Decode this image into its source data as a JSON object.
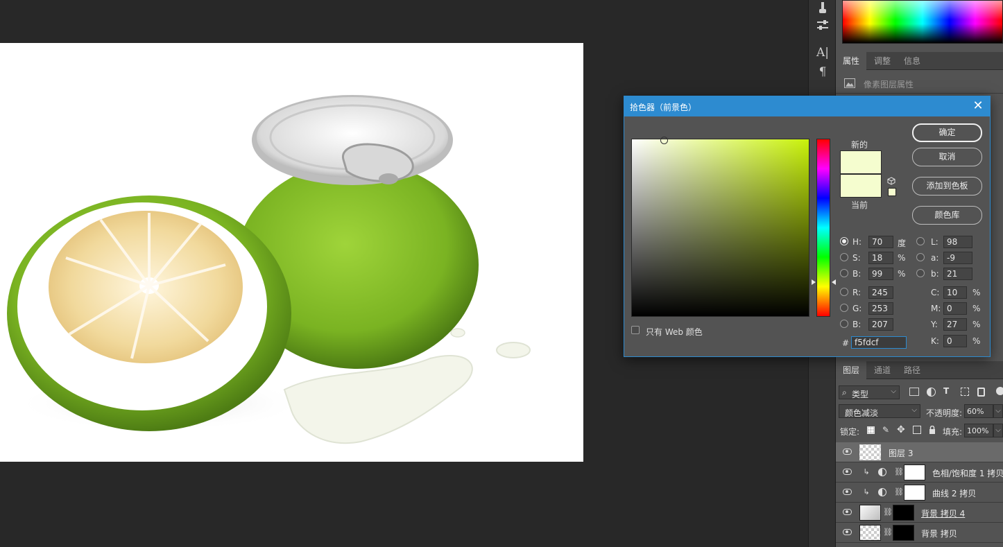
{
  "dialog": {
    "title": "拾色器（前景色）",
    "new_label": "新的",
    "current_label": "当前",
    "new_color": "#f5fdcf",
    "current_color": "#f5fdcf",
    "buttons": {
      "ok": "确定",
      "cancel": "取消",
      "add_swatch": "添加到色板",
      "color_library": "颜色库"
    },
    "web_only_label": "只有 Web 颜色",
    "web_only_checked": false,
    "hsb": [
      {
        "label": "H:",
        "value": "70",
        "unit": "度",
        "selected": true
      },
      {
        "label": "S:",
        "value": "18",
        "unit": "%",
        "selected": false
      },
      {
        "label": "B:",
        "value": "99",
        "unit": "%",
        "selected": false
      }
    ],
    "lab": [
      {
        "label": "L:",
        "value": "98"
      },
      {
        "label": "a:",
        "value": "-9"
      },
      {
        "label": "b:",
        "value": "21"
      }
    ],
    "rgb": [
      {
        "label": "R:",
        "value": "245"
      },
      {
        "label": "G:",
        "value": "253"
      },
      {
        "label": "B:",
        "value": "207"
      }
    ],
    "cmyk": [
      {
        "label": "C:",
        "value": "10",
        "unit": "%"
      },
      {
        "label": "M:",
        "value": "0",
        "unit": "%"
      },
      {
        "label": "Y:",
        "value": "27",
        "unit": "%"
      },
      {
        "label": "K:",
        "value": "0",
        "unit": "%"
      }
    ],
    "hex_label": "#",
    "hex_value": "f5fdcf",
    "hue_color": "#c9f20a"
  },
  "properties_panel": {
    "tabs": [
      "属性",
      "调整",
      "信息"
    ],
    "active_tab": "属性",
    "subtitle": "像素图层属性"
  },
  "layers_panel": {
    "tabs": [
      "图层",
      "通道",
      "路径"
    ],
    "active_tab": "图层",
    "filter_label": "类型",
    "blend_mode": "颜色减淡",
    "opacity_label": "不透明度:",
    "opacity_value": "60%",
    "lock_label": "锁定:",
    "fill_label": "填充:",
    "fill_value": "100%",
    "layers": [
      {
        "name": "图层 3",
        "selected": true
      },
      {
        "name": "色相/饱和度 1 拷贝",
        "selected": false
      },
      {
        "name": "曲线 2 拷贝",
        "selected": false
      },
      {
        "name": "背景 拷贝 4",
        "selected": false
      },
      {
        "name": "背景 拷贝",
        "selected": false
      }
    ]
  },
  "toolbar_strip": {
    "icons": [
      "brush-settings-icon",
      "adjust-sliders-icon",
      "character-icon",
      "paragraph-icon"
    ]
  },
  "canvas": {
    "background": "#ffffff",
    "workspace": "#282828"
  }
}
